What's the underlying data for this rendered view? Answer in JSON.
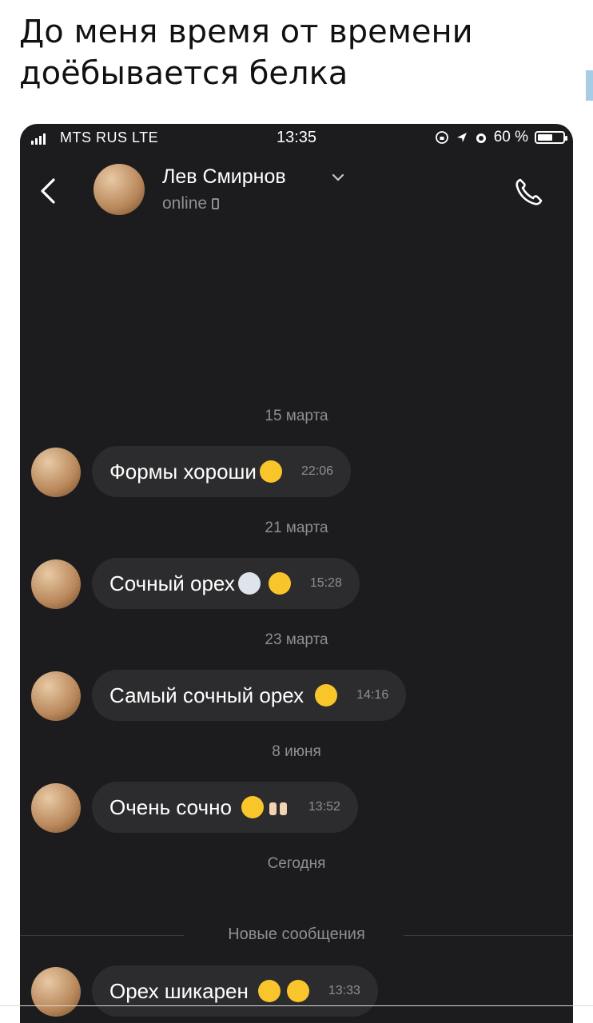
{
  "tweet": {
    "title": "До меня время от времени доёбывается белка"
  },
  "status_bar": {
    "carrier": "MTS RUS  LTE",
    "time": "13:35",
    "battery_text": "60 %",
    "battery_level": 0.6
  },
  "header": {
    "contact_name": "Лев Смирнов",
    "status": "online"
  },
  "messages": [
    {
      "date": "15 марта",
      "text": "Формы хороши",
      "emojis": [
        "smirk"
      ],
      "time": "22:06"
    },
    {
      "date": "21 марта",
      "text": "Сочный орех",
      "emojis": [
        "scream",
        "heart-eyes"
      ],
      "time": "15:28"
    },
    {
      "date": "23 марта",
      "text": "Самый сочный орех",
      "emojis": [
        "heart-eyes"
      ],
      "time": "14:16"
    },
    {
      "date": "8 июня",
      "text": "Очень сочно",
      "emojis": [
        "yum",
        "raised-hands"
      ],
      "time": "13:52"
    },
    {
      "date": "Сегодня",
      "text": "",
      "emojis": [],
      "time": ""
    }
  ],
  "new_messages_label": "Новые сообщения",
  "new_message": {
    "text": "Орех шикарен",
    "emojis": [
      "yum",
      "relieved"
    ],
    "time": "13:33"
  },
  "icons": {
    "back": "chevron-left-icon",
    "call": "phone-icon",
    "name_dropdown": "chevron-down-icon",
    "device": "mobile-device-icon"
  }
}
